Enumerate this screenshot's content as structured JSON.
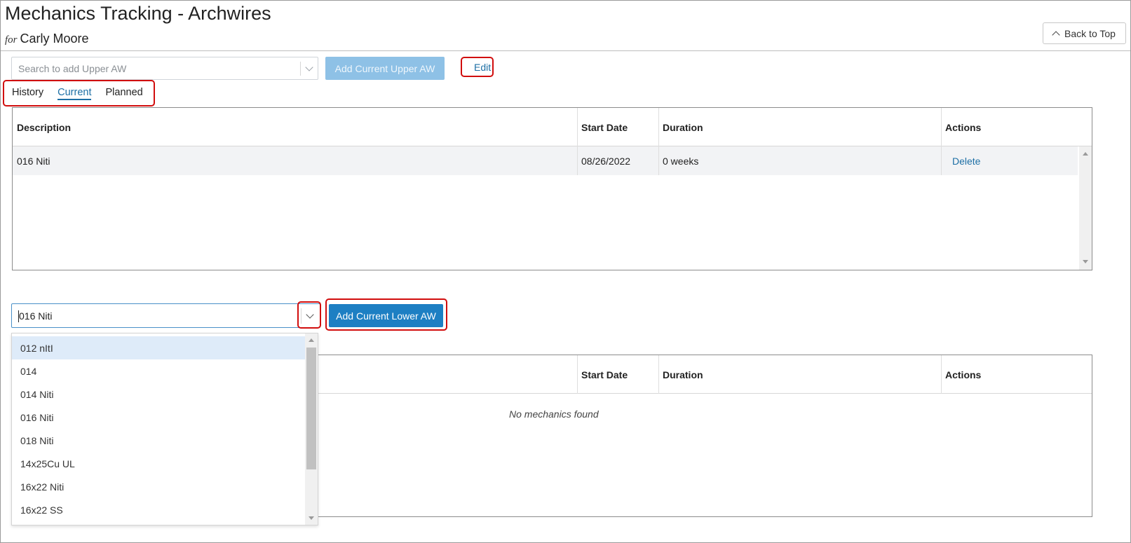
{
  "header": {
    "title": "Mechanics Tracking - Archwires",
    "for_prefix": "for",
    "patient_name": "Carly Moore",
    "back_to_top": "Back to Top"
  },
  "upper": {
    "search_placeholder": "Search to add Upper AW",
    "add_button": "Add Current Upper AW",
    "edit_link": "Edit",
    "tabs": [
      "History",
      "Current",
      "Planned"
    ],
    "active_tab": "Current",
    "columns": [
      "Description",
      "Start Date",
      "Duration",
      "Actions"
    ],
    "rows": [
      {
        "description": "016 Niti",
        "start_date": "08/26/2022",
        "duration": "0 weeks",
        "action": "Delete"
      }
    ]
  },
  "lower": {
    "input_value": "016 Niti",
    "add_button": "Add Current Lower AW",
    "columns": [
      "Start Date",
      "Duration",
      "Actions"
    ],
    "empty_message": "No mechanics found",
    "dropdown_options": [
      "012 nItI",
      "014",
      "014 Niti",
      "016 Niti",
      "018 Niti",
      "14x25Cu UL",
      "16x22 Niti",
      "16x22 SS"
    ],
    "hovered_option": "012 nItI"
  },
  "colors": {
    "primary": "#1d7fc3",
    "primary_disabled": "#8ec1e6",
    "link": "#1d6fa5",
    "highlight": "#d10d0d",
    "hover_option": "#deebf9"
  }
}
